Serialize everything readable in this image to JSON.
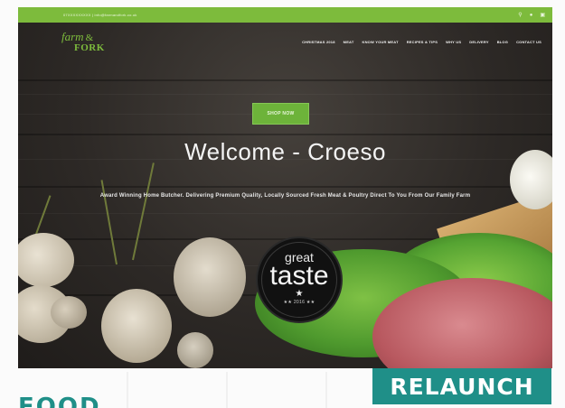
{
  "topbar": {
    "contact": "07XXXXXXXXX  |  info@farmandfork.co.uk",
    "icons": [
      "search-icon",
      "user-icon",
      "cart-icon"
    ]
  },
  "logo": {
    "farm": "farm",
    "amp": "&",
    "fork": "FORK"
  },
  "nav": {
    "items": [
      "CHRISTMAS 2018",
      "MEAT",
      "KNOW YOUR MEAT",
      "RECIPES & TIPS",
      "WHY US",
      "DELIVERY",
      "BLOG",
      "CONTACT US"
    ]
  },
  "hero": {
    "shop_button": "SHOP NOW",
    "title": "Welcome - Croeso",
    "tagline": "Award Winning Home Butcher. Delivering Premium Quality, Locally Sourced Fresh Meat & Poultry Direct To You From Our Family Farm"
  },
  "badge": {
    "great": "great",
    "taste": "taste",
    "star": "★",
    "year": "★★ 2016 ★★"
  },
  "magazine": {
    "relaunch": "RELAUNCH",
    "heading": "FOOD"
  },
  "colors": {
    "brand_green": "#7dbb3c",
    "button_green": "#6db33a",
    "teal": "#1f8f88"
  }
}
